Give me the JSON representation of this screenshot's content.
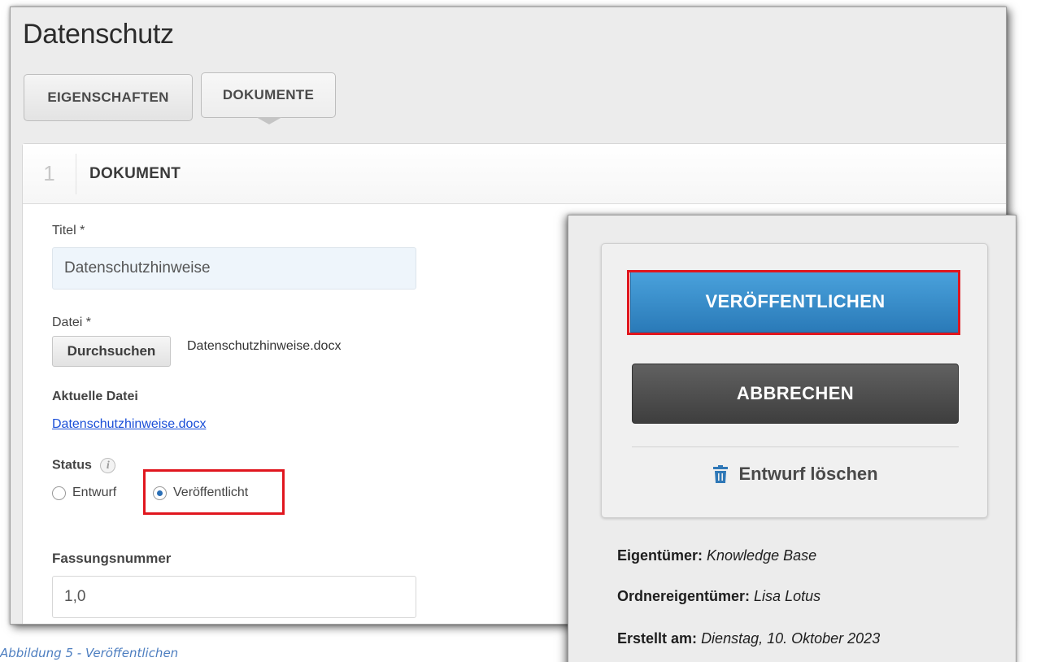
{
  "page": {
    "title": "Datenschutz",
    "tabs": [
      {
        "label": "EIGENSCHAFTEN"
      },
      {
        "label": "DOKUMENTE"
      }
    ]
  },
  "section": {
    "number": "1",
    "title": "DOKUMENT"
  },
  "form": {
    "title_label": "Titel *",
    "title_value": "Datenschutzhinweise",
    "file_label": "Datei *",
    "browse_label": "Durchsuchen",
    "file_name": "Datenschutzhinweise.docx",
    "current_file_label": "Aktuelle Datei",
    "current_file_link": "Datenschutzhinweise.docx",
    "status_label": "Status",
    "status_info_icon": "info-icon",
    "status_options": [
      {
        "label": "Entwurf",
        "selected": false
      },
      {
        "label": "Veröffentlicht",
        "selected": true
      }
    ],
    "version_label": "Fassungsnummer",
    "version_value": "1,0"
  },
  "popup": {
    "publish_label": "VERÖFFENTLICHEN",
    "cancel_label": "ABBRECHEN",
    "delete_label": "Entwurf löschen",
    "delete_icon": "trash-icon",
    "meta": [
      {
        "key": "Eigentümer:",
        "value": "Knowledge Base"
      },
      {
        "key": "Ordnereigentümer:",
        "value": "Lisa Lotus"
      },
      {
        "key": "Erstellt am:",
        "value": "Dienstag, 10. Oktober 2023"
      }
    ]
  },
  "caption": "Abbildung 5 - Veröffentlichen",
  "colors": {
    "highlight": "#e0161e",
    "publish_button": "#3a8fcc",
    "cancel_button": "#4d4d4d",
    "link": "#1a4fd8",
    "trash_icon": "#2f78b7",
    "caption": "#4d7ec0"
  }
}
